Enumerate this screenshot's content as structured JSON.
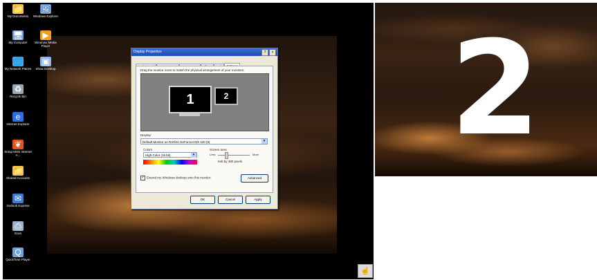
{
  "monitor1": {
    "desktop_icons": [
      {
        "label": "My Documents",
        "icon": "folder-icon",
        "color": "#f3c64a",
        "glyph": "📁"
      },
      {
        "label": "Windows Explorer",
        "icon": "explorer-icon",
        "color": "#4f86c9",
        "glyph": "🖼"
      },
      {
        "label": "My Computer",
        "icon": "computer-icon",
        "color": "#6ea2d9",
        "glyph": "🖥"
      },
      {
        "label": "Windows Media Player",
        "icon": "media-player-icon",
        "color": "#f0a020",
        "glyph": "▶"
      },
      {
        "label": "My Network Places",
        "icon": "network-icon",
        "color": "#5fa1d8",
        "glyph": "🌐"
      },
      {
        "label": "Show Desktop",
        "icon": "show-desktop-icon",
        "color": "#8fb5e4",
        "glyph": "▣"
      },
      {
        "label": "Recycle Bin",
        "icon": "recycle-bin-icon",
        "color": "#9aa7b8",
        "glyph": "♻"
      },
      {
        "label": "Internet Explorer",
        "icon": "internet-explorer-icon",
        "color": "#2d6ee0",
        "glyph": "e"
      },
      {
        "label": "Setup MSN Internet A...",
        "icon": "msn-icon",
        "color": "#e0571f",
        "glyph": "❦"
      },
      {
        "label": "Shared Accounts",
        "icon": "folder-icon",
        "color": "#f3c64a",
        "glyph": "📁"
      },
      {
        "label": "Outlook Express",
        "icon": "outlook-express-icon",
        "color": "#3a7bd5",
        "glyph": "✉"
      },
      {
        "label": "Scan",
        "icon": "scan-icon",
        "color": "#9fb3c8",
        "glyph": "⎙"
      },
      {
        "label": "QuickTime Player",
        "icon": "quicktime-icon",
        "color": "#6aa5dd",
        "glyph": "Q"
      }
    ]
  },
  "dialog": {
    "title": "Display Properties",
    "title_buttons": [
      "?",
      "×"
    ],
    "tabs": [
      "Background",
      "Screen Saver",
      "Appearance",
      "Effects",
      "Web",
      "Settings"
    ],
    "active_tab": "Settings",
    "instruction": "Drag the monitor icons to match the physical arrangement of your monitors.",
    "monitors": [
      "1",
      "2"
    ],
    "display_label": "Display:",
    "display_value": "Default Monitor on NVIDIA GeForce4 MX 420 (5)",
    "colors_label": "Colors",
    "colors_value": "High Color (16 bit)",
    "resolution_label": "Screen area",
    "resolution_less": "Less",
    "resolution_more": "More",
    "resolution_value": "640 by 480 pixels",
    "resolution_level": 0.25,
    "extend_label": "Extend my Windows desktop onto this monitor.",
    "extend_checked": true,
    "advanced_label": "Advanced",
    "ok_label": "OK",
    "cancel_label": "Cancel",
    "apply_label": "Apply"
  },
  "monitor2": {
    "identifier": "2"
  },
  "taskbar": {
    "tray_icon": "hand-pointer-icon",
    "tray_glyph": "☝"
  },
  "colors": {
    "titlebar": "#1c4bb5",
    "dialog_bg": "#ece9d8",
    "monitor_area": "#808080"
  }
}
